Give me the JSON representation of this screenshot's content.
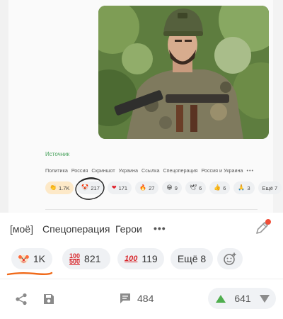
{
  "post_screenshot": {
    "source_label": "Источник",
    "tags": [
      "Политика",
      "Россия",
      "Скриншот",
      "Украина",
      "Ссылка",
      "Спецоперация",
      "Россия и Украина"
    ],
    "tags_more": "•••",
    "reactions": [
      {
        "icon": "clap-emoji",
        "glyph": "👏",
        "count": "1.7K"
      },
      {
        "icon": "clown-emoji",
        "glyph": "🤡",
        "count": "217"
      },
      {
        "icon": "heart-emoji",
        "glyph": "❤",
        "count": "171"
      },
      {
        "icon": "fire-emoji",
        "glyph": "🔥",
        "count": "27"
      },
      {
        "icon": "laugh-emoji",
        "glyph": "😁",
        "count": "9"
      },
      {
        "icon": "dove-emoji",
        "glyph": "🕊",
        "count": "6"
      },
      {
        "icon": "thumbs-emoji",
        "glyph": "👍",
        "count": "6"
      },
      {
        "icon": "pray-emoji",
        "glyph": "🙏",
        "count": "3"
      }
    ],
    "reactions_more": "Ещё 7"
  },
  "tagbar": {
    "tags": [
      "[моё]",
      "Спецоперация",
      "Герои"
    ],
    "more": "•••"
  },
  "reactions": {
    "clown_count": "1K",
    "r100500_top": "100",
    "r100500_bottom": "500",
    "r100500_count": "821",
    "r100_label": "100",
    "r100_count": "119",
    "more_label": "Ещё 8"
  },
  "actions": {
    "comments_count": "484",
    "rating": "641"
  },
  "colors": {
    "accent_green": "#4aa35e",
    "hundred_red": "#d8262b",
    "underline_orange": "#f06a1a",
    "edit_badge": "#f04e38"
  }
}
